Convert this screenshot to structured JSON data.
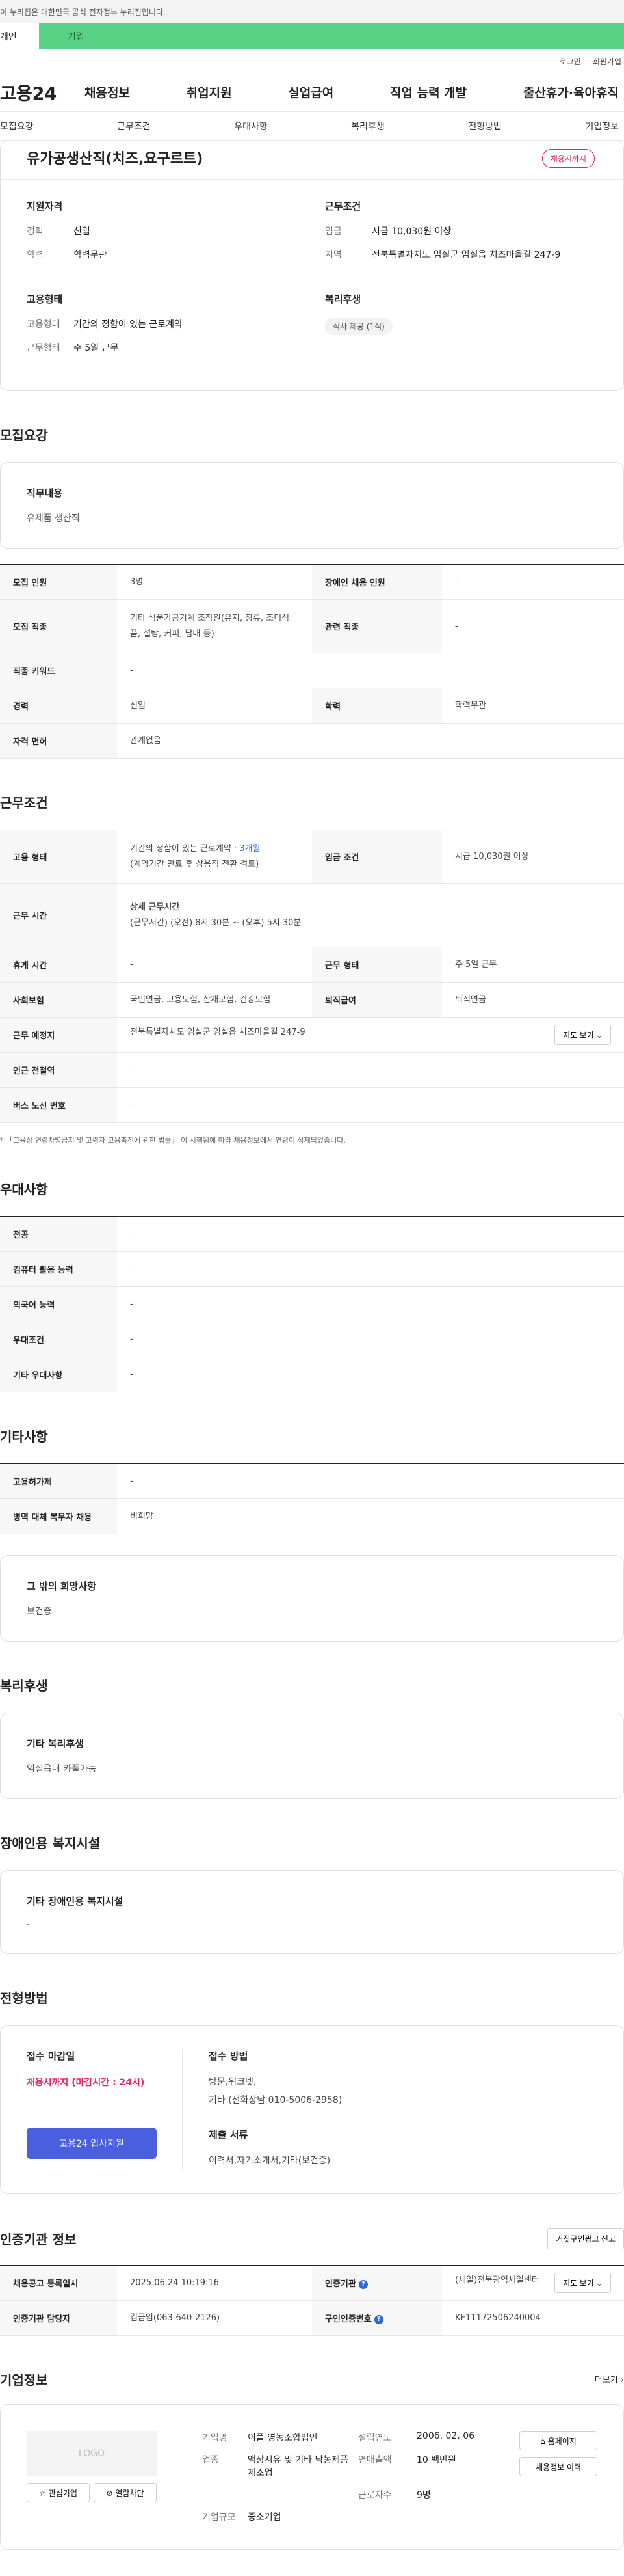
{
  "gov_banner": "이 누리집은 대한민국 공식 전자정부 누리집입니다.",
  "user_tabs": {
    "personal": "개인",
    "company": "기업"
  },
  "util": {
    "login": "로그인",
    "signup": "회원가입"
  },
  "logo": "고용24",
  "gnb": [
    "채용정보",
    "취업지원",
    "실업급여",
    "직업 능력 개발",
    "출산휴가·육아휴직"
  ],
  "anchors": [
    "모집요강",
    "근무조건",
    "우대사항",
    "복리후생",
    "전형방법",
    "기업정보"
  ],
  "job": {
    "title": "유가공생산직(치즈,요구르트)",
    "badge": "채용시까지",
    "qualification": {
      "title": "지원자격",
      "career_k": "경력",
      "career_v": "신입",
      "edu_k": "학력",
      "edu_v": "학력무관"
    },
    "conditions": {
      "title": "근무조건",
      "wage_k": "임금",
      "wage_v": "시급 10,030원 이상",
      "region_k": "지역",
      "region_v": "전북특별자치도 임실군 임실읍 치즈마을길 247-9"
    },
    "employment": {
      "title": "고용형태",
      "type_k": "고용형태",
      "type_v": "기간의 정함이 있는 근로계약",
      "work_k": "근무형태",
      "work_v": "주 5일 근무"
    },
    "welfare": {
      "title": "복리후생",
      "pill": "식사 제공 (1식)"
    }
  },
  "recruit": {
    "title": "모집요강",
    "duty_title": "직무내용",
    "duty_value": "유제품 생산직",
    "rows": {
      "count_k": "모집 인원",
      "count_v": "3명",
      "disabled_k": "장애인 채용 인원",
      "disabled_v": "-",
      "job_k": "모집 직종",
      "job_v": "기타 식품가공기계 조작원(유지, 장류, 조미식품, 설탕, 커피, 담배 등)",
      "related_k": "관련 직종",
      "related_v": "-",
      "keyword_k": "직종 키워드",
      "keyword_v": "-",
      "career_k": "경력",
      "career_v": "신입",
      "edu_k": "학력",
      "edu_v": "학력무관",
      "license_k": "자격 면허",
      "license_v": "관계없음"
    }
  },
  "work": {
    "title": "근무조건",
    "type_k": "고용 형태",
    "type_v1": "기간의 정함이 있는 근로계약 · ",
    "type_v1_accent": "3개월",
    "type_v2": "(계약기간 만료 후 상용직 전환 검토)",
    "wage_k": "임금 조건",
    "wage_v": "시급 10,030원 이상",
    "hours_k": "근무 시간",
    "hours_title": "상세 근무시간",
    "hours_v": "(근무시간) (오전) 8시 30분 ~ (오후) 5시 30분",
    "break_k": "휴게 시간",
    "break_v": "-",
    "form_k": "근무 형태",
    "form_v": "주 5일 근무",
    "insurance_k": "사회보험",
    "insurance_v": "국민연금, 고용보험, 산재보험, 건강보험",
    "severance_k": "퇴직급여",
    "severance_v": "퇴직연금",
    "place_k": "근무 예정지",
    "place_v": "전북특별자치도 임실군 임실읍 치즈마을길 247-9",
    "map_btn": "지도 보기 ⌄",
    "subway_k": "인근 전철역",
    "subway_v": "-",
    "bus_k": "버스 노선 번호",
    "bus_v": "-",
    "note": "* 「고용상 연령차별금지 및 고령자 고용촉진에 관한 법률」 이 시행됨에 따라 채용정보에서 연령이 삭제되었습니다."
  },
  "pref": {
    "title": "우대사항",
    "major_k": "전공",
    "major_v": "-",
    "pc_k": "컴퓨터 활용 능력",
    "pc_v": "-",
    "lang_k": "외국어 능력",
    "lang_v": "-",
    "cond_k": "우대조건",
    "cond_v": "-",
    "etc_k": "기타 우대사항",
    "etc_v": "-"
  },
  "etc": {
    "title": "기타사항",
    "support_k": "고용허가제",
    "support_v": "-",
    "military_k": "병역 대체 복무자 채용",
    "military_v": "비희망",
    "hope_title": "그 밖의 희망사항",
    "hope_value": "보건증"
  },
  "welfare": {
    "title": "복리후생",
    "box_title": "기타 복리후생",
    "box_value": "임실읍내 카풀가능"
  },
  "disabled": {
    "title": "장애인용 복지시설",
    "box_title": "기타 장애인용 복지시설",
    "box_value": "-"
  },
  "selection": {
    "title": "전형방법",
    "deadline_title": "접수 마감일",
    "deadline_value": "채용시까지 (마감시간 : 24시)",
    "apply_btn": "고용24 입사지원",
    "method_title": "접수 방법",
    "method_1": "방문,워크넷,",
    "method_2": "기타 (전화상담 010-5006-2958)",
    "docs_title": "제출 서류",
    "docs_value": "이력서,자기소개서,기타(보건증)"
  },
  "cert": {
    "title": "인증기관 정보",
    "report_btn": "거짓구인광고 신고",
    "reg_k": "채용공고 등록일시",
    "reg_v": "2025.06.24 10:19:16",
    "org_k": "인증기관",
    "org_v": "(새일)전북광역새일센터",
    "map_btn": "지도 보기 ⌄",
    "manager_k": "인증기관 담당자",
    "manager_v": "김금임(063-640-2126)",
    "cert_no_k": "구인인증번호",
    "cert_no_v": "KF11172506240004"
  },
  "company": {
    "title": "기업정보",
    "more": "더보기 ›",
    "logo_text": "LOGO",
    "interest_btn": "☆ 관심기업",
    "block_btn": "⊘ 열람차단",
    "name_k": "기업명",
    "name_v": "이플 영농조합법인",
    "found_k": "설립연도",
    "found_v": "2006. 02. 06",
    "industry_k": "업종",
    "industry_v": "액상시유 및 기타 낙농제품 제조업",
    "sales_k": "연매출액",
    "sales_v": "10 백만원",
    "staff_k": "근로자수",
    "staff_v": "9명",
    "size_k": "기업규모",
    "size_v": "중소기업",
    "home_btn": "⌂ 홈페이지",
    "history_btn": "채용정보 이력"
  }
}
